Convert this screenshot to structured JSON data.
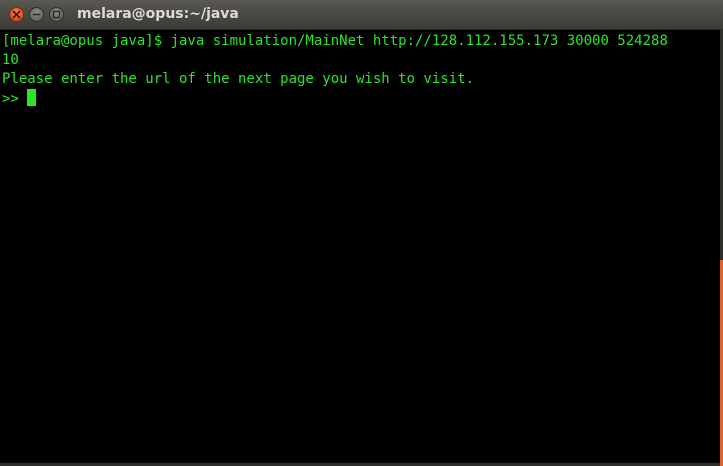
{
  "window": {
    "title": "melara@opus:~/java",
    "buttons": {
      "close": "close-icon",
      "minimize": "minimize-icon",
      "maximize": "maximize-icon"
    },
    "close_color": "#e05b27"
  },
  "terminal": {
    "text_color": "#29e629",
    "background": "#000000",
    "lines": [
      "[melara@opus java]$ java simulation/MainNet http://128.112.155.173 30000 524288",
      "10",
      "Please enter the url of the next page you wish to visit.",
      ">>"
    ]
  }
}
